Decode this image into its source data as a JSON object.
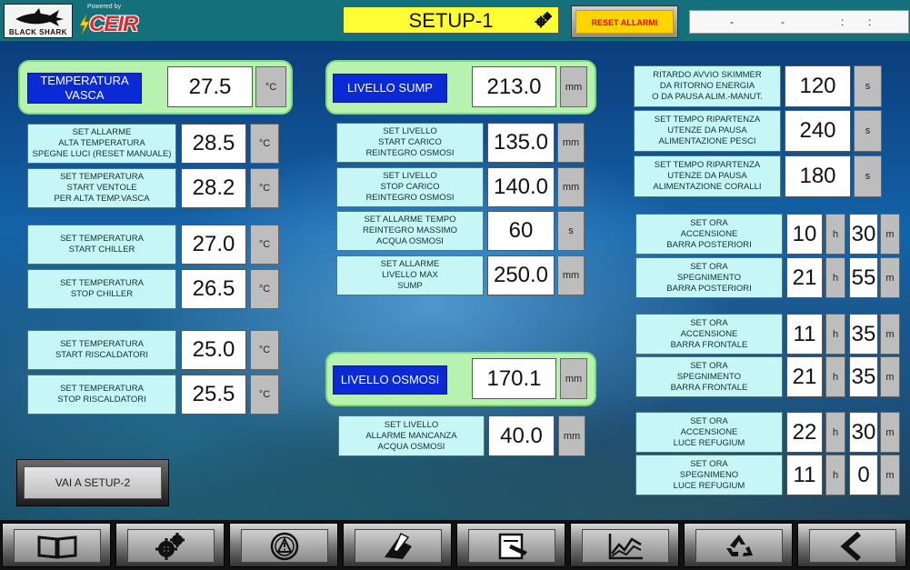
{
  "header": {
    "brand_name": "BLACK SHARK",
    "powered_by": "Powered by",
    "vendor_name": "CEIR",
    "title": "SETUP-1",
    "reset_label": "RESET ALLARMI",
    "datetime": {
      "d1": "-",
      "d2": "-",
      "t1": ":",
      "t2": ":"
    }
  },
  "vasca": {
    "title": "TEMPERATURA\nVASCA",
    "value": "27.5",
    "unit": "°C",
    "rows": [
      {
        "label": "SET ALLARME\nALTA TEMPERATURA\nSPEGNE LUCI (RESET MANUALE)",
        "value": "28.5",
        "unit": "°C"
      },
      {
        "label": "SET TEMPERATURA\nSTART VENTOLE\nPER ALTA TEMP.VASCA",
        "value": "28.2",
        "unit": "°C"
      },
      {
        "label": "SET TEMPERATURA\nSTART CHILLER",
        "value": "27.0",
        "unit": "°C"
      },
      {
        "label": "SET TEMPERATURA\nSTOP CHILLER",
        "value": "26.5",
        "unit": "°C"
      },
      {
        "label": "SET TEMPERATURA\nSTART RISCALDATORI",
        "value": "25.0",
        "unit": "°C"
      },
      {
        "label": "SET TEMPERATURA\nSTOP RISCALDATORI",
        "value": "25.5",
        "unit": "°C"
      }
    ]
  },
  "sump": {
    "title": "LIVELLO SUMP",
    "value": "213.0",
    "unit": "mm",
    "rows": [
      {
        "label": "SET LIVELLO\nSTART CARICO\nREINTEGRO OSMOSI",
        "value": "135.0",
        "unit": "mm"
      },
      {
        "label": "SET LIVELLO\nSTOP CARICO\nREINTEGRO OSMOSI",
        "value": "140.0",
        "unit": "mm"
      },
      {
        "label": "SET ALLARME TEMPO\nREINTEGRO MASSIMO\nACQUA OSMOSI",
        "value": "60",
        "unit": "s"
      },
      {
        "label": "SET ALLARME\nLIVELLO MAX\nSUMP",
        "value": "250.0",
        "unit": "mm"
      }
    ]
  },
  "osmosi": {
    "title": "LIVELLO OSMOSI",
    "value": "170.1",
    "unit": "mm",
    "rows": [
      {
        "label": "SET LIVELLO\nALLARME MANCANZA\nACQUA OSMOSI",
        "value": "40.0",
        "unit": "mm"
      }
    ]
  },
  "timers": [
    {
      "label": "RITARDO AVVIO SKIMMER\nDA RITORNO ENERGIA\nO DA PAUSA ALIM.-MANUT.",
      "value": "120",
      "unit": "s"
    },
    {
      "label": "SET TEMPO RIPARTENZA\nUTENZE DA PAUSA\nALIMENTAZIONE PESCI",
      "value": "240",
      "unit": "s"
    },
    {
      "label": "SET TEMPO RIPARTENZA\nUTENZE DA PAUSA\nALIMENTAZIONE CORALLI",
      "value": "180",
      "unit": "s"
    }
  ],
  "schedules": [
    {
      "label": "SET ORA\nACCENSIONE\nBARRA POSTERIORI",
      "hour": "10",
      "h_unit": "h",
      "minute": "30",
      "m_unit": "m"
    },
    {
      "label": "SET ORA\nSPEGNIMENTO\nBARRA POSTERIORI",
      "hour": "21",
      "h_unit": "h",
      "minute": "55",
      "m_unit": "m"
    },
    {
      "label": "SET ORA\nACCENSIONE\nBARRA FRONTALE",
      "hour": "11",
      "h_unit": "h",
      "minute": "35",
      "m_unit": "m"
    },
    {
      "label": "SET ORA\nSPEGNIMENTO\nBARRA FRONTALE",
      "hour": "21",
      "h_unit": "h",
      "minute": "35",
      "m_unit": "m"
    },
    {
      "label": "SET ORA\nACCENSIONE\nLUCE REFUGIUM",
      "hour": "22",
      "h_unit": "h",
      "minute": "30",
      "m_unit": "m"
    },
    {
      "label": "SET ORA\nSPEGNIMENO\nLUCE REFUGIUM",
      "hour": "11",
      "h_unit": "h",
      "minute": "0",
      "m_unit": "m"
    }
  ],
  "nav": {
    "goto_setup2": "VAI A SETUP-2"
  },
  "toolbar": {
    "icons": [
      "book-icon",
      "gears-icon",
      "alarm-warning-icon",
      "pen-paper-icon",
      "document-edit-icon",
      "trend-chart-icon",
      "recycle-icon",
      "back-arrow-icon"
    ]
  }
}
